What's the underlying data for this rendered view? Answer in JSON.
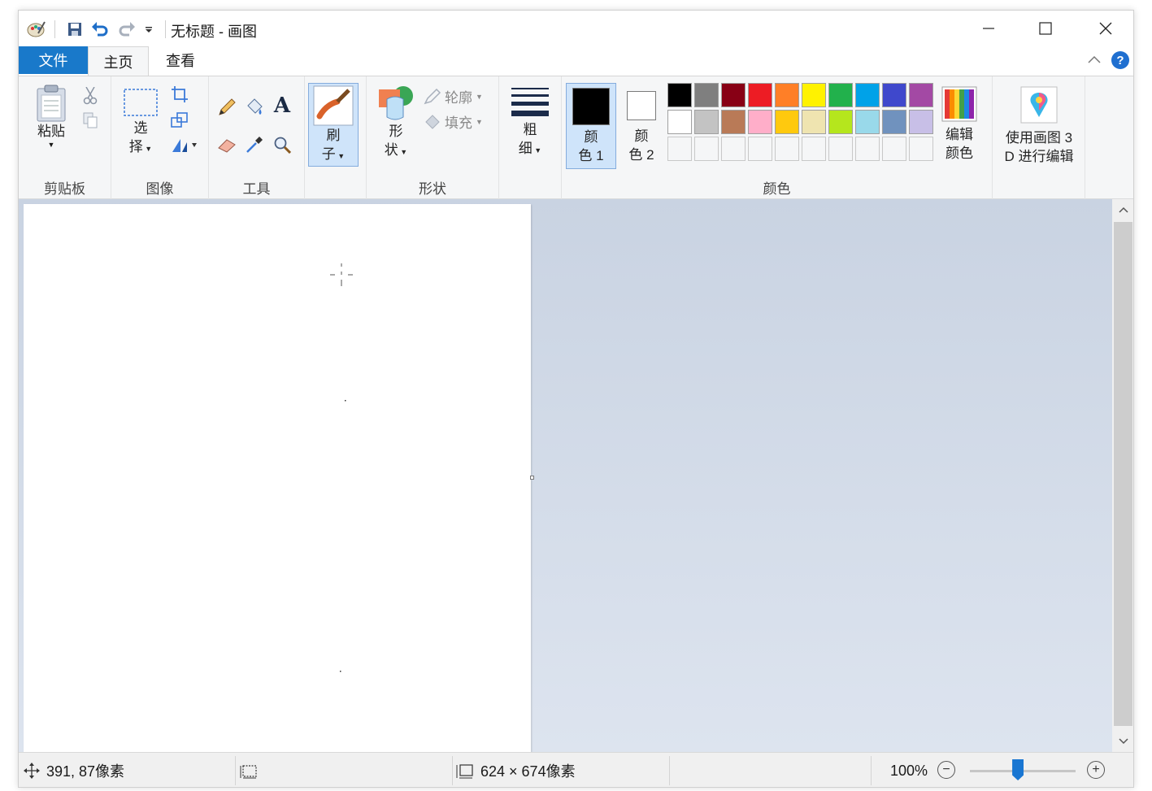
{
  "window": {
    "title": "无标题 - 画图"
  },
  "tabs": {
    "file": "文件",
    "home": "主页",
    "view": "查看"
  },
  "ribbon": {
    "clipboard": {
      "label": "剪贴板",
      "paste": "粘贴"
    },
    "image": {
      "label": "图像",
      "select_top": "选",
      "select_bottom": "择"
    },
    "tools": {
      "label": "工具",
      "text_glyph": "A"
    },
    "brush": {
      "top": "刷",
      "bottom": "子"
    },
    "shapes": {
      "label": "形状",
      "shapes_top": "形",
      "shapes_bottom": "状",
      "outline": "轮廓",
      "fill": "填充"
    },
    "size": {
      "top": "粗",
      "bottom": "细"
    },
    "colors": {
      "label": "颜色",
      "color1_top": "颜",
      "color1_bottom": "色 1",
      "color2_top": "颜",
      "color2_bottom": "色 2",
      "color1_value": "#000000",
      "color2_value": "#ffffff",
      "palette_row1": [
        "#000000",
        "#7f7f7f",
        "#880015",
        "#ed1c24",
        "#ff7f27",
        "#fff200",
        "#22b14c",
        "#00a2e8",
        "#3f48cc",
        "#a349a4"
      ],
      "palette_row2": [
        "#ffffff",
        "#c3c3c3",
        "#b97a57",
        "#ffaec9",
        "#ffc90e",
        "#efe4b0",
        "#b5e61d",
        "#99d9ea",
        "#7092be",
        "#c8bfe7"
      ],
      "palette_row3_count": 10,
      "edit_top": "编辑",
      "edit_bottom": "颜色"
    },
    "paint3d": {
      "top": "使用画图 3",
      "bottom": "D 进行编辑"
    }
  },
  "status": {
    "cursor_pos": "391, 87像素",
    "canvas_size": "624 × 674像素",
    "zoom": "100%",
    "zoom_level": 1.0
  },
  "icons": [
    "app-icon",
    "save-icon",
    "undo-icon",
    "redo-icon",
    "customize-icon",
    "minimize-icon",
    "maximize-icon",
    "close-icon",
    "collapse-ribbon-icon",
    "help-icon",
    "cut-icon",
    "copy-icon",
    "crop-icon",
    "resize-icon",
    "rotate-icon",
    "pencil-icon",
    "fill-bucket-icon",
    "text-icon",
    "eraser-icon",
    "color-picker-icon",
    "magnifier-icon",
    "move-cursor-icon",
    "selection-size-icon",
    "canvas-size-icon"
  ]
}
